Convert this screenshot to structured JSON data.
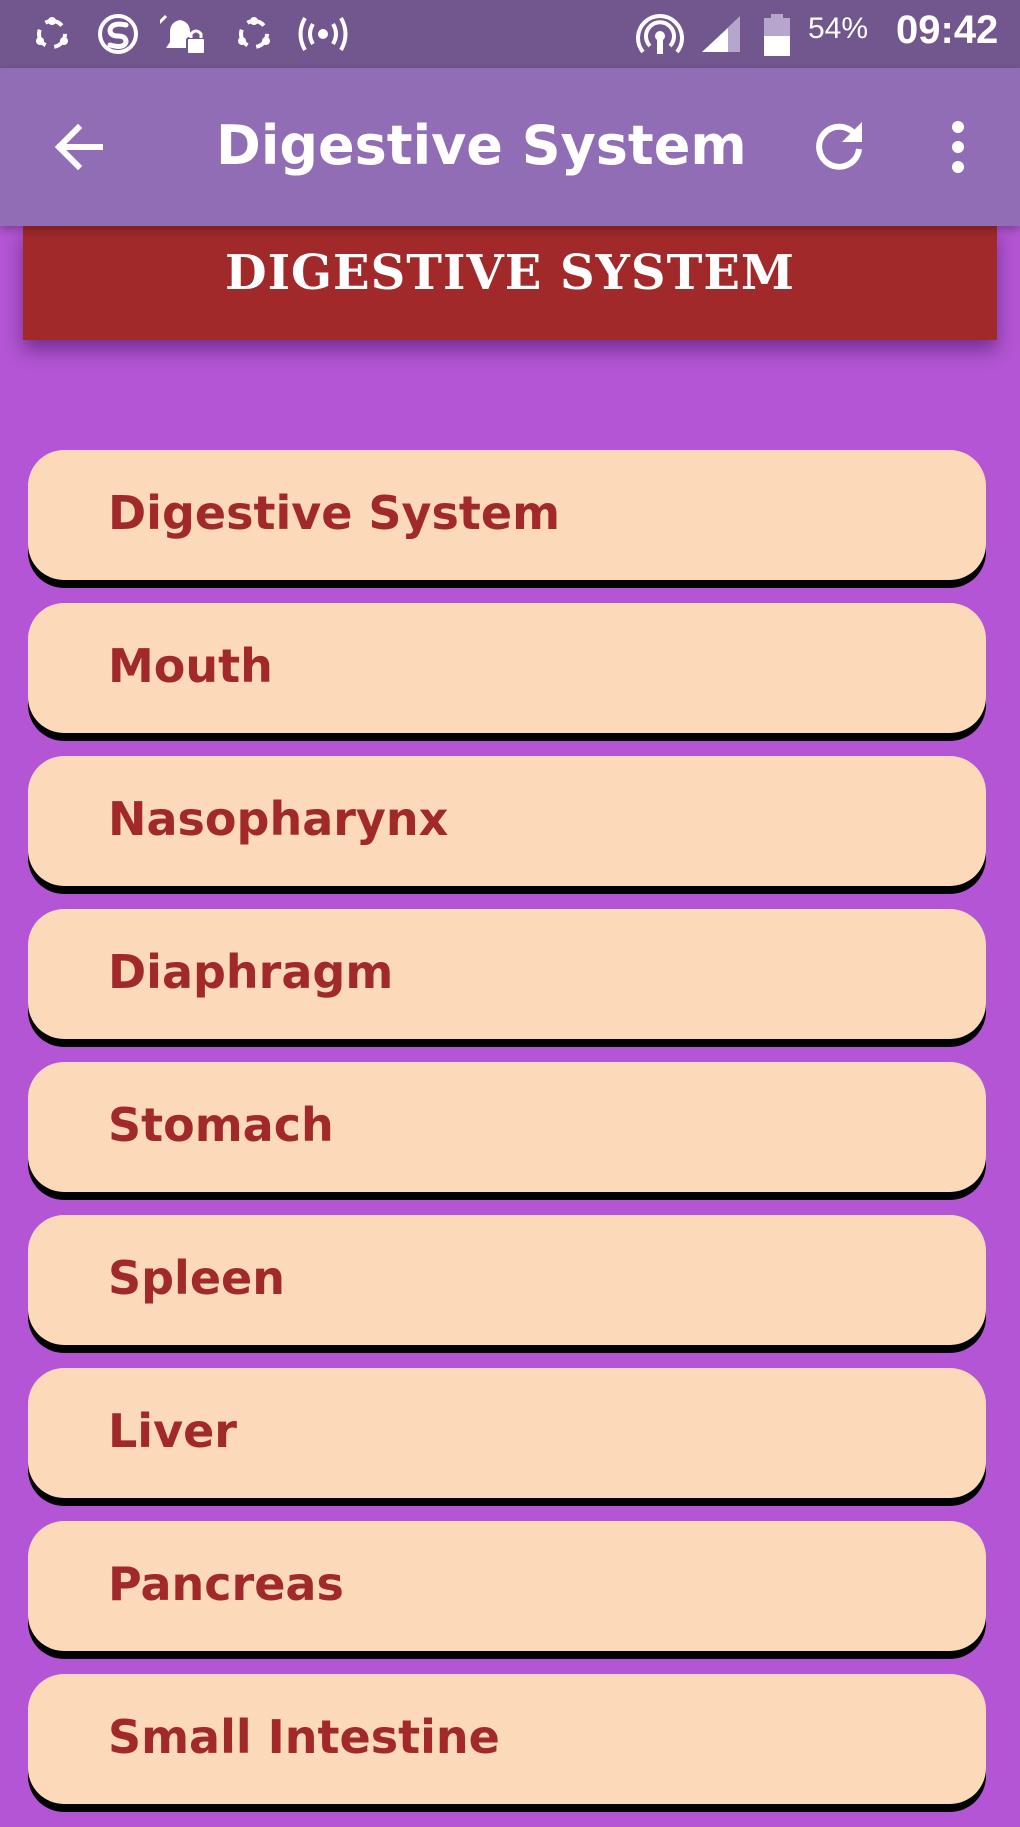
{
  "status_bar": {
    "battery": "54%",
    "time": "09:42",
    "icons": [
      "sync-icon",
      "s-app-icon",
      "notification-lock-icon",
      "sync-alt-icon",
      "broadcast-icon",
      "hotspot-icon",
      "signal-icon",
      "battery-icon"
    ]
  },
  "app_bar": {
    "title": "Digestive System",
    "back_icon": "arrow-left-icon",
    "refresh_icon": "refresh-icon",
    "more_icon": "more-vert-icon"
  },
  "banner": {
    "title": "DIGESTIVE SYSTEM"
  },
  "list": {
    "items": [
      {
        "label": "Digestive System"
      },
      {
        "label": "Mouth"
      },
      {
        "label": "Nasopharynx"
      },
      {
        "label": "Diaphragm"
      },
      {
        "label": "Stomach"
      },
      {
        "label": "Spleen"
      },
      {
        "label": "Liver"
      },
      {
        "label": "Pancreas"
      },
      {
        "label": "Small Intestine"
      }
    ]
  },
  "colors": {
    "status_bar": "#72568e",
    "app_bar": "#906db5",
    "background": "#b455d5",
    "banner": "#a1292a",
    "item_background": "#fcd9b8",
    "item_text": "#a1292a",
    "item_shadow": "#000000"
  }
}
